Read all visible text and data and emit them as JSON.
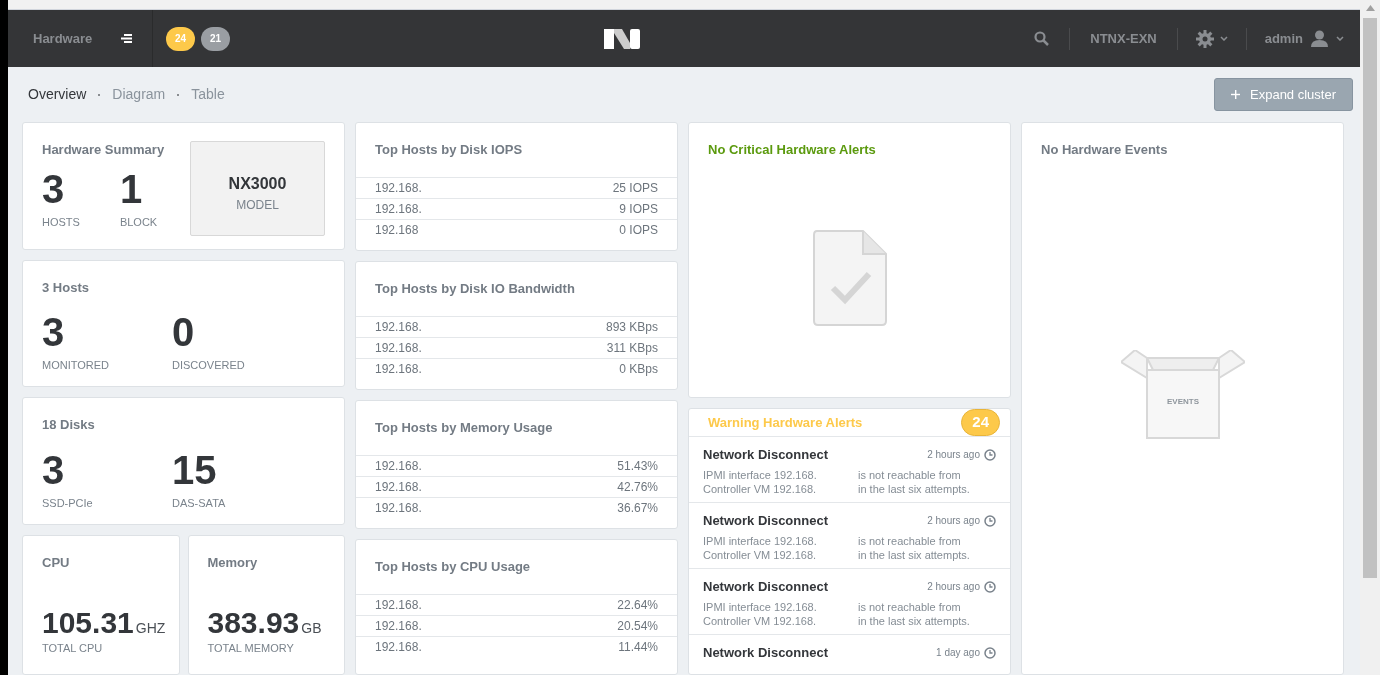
{
  "topbar": {
    "section": "Hardware",
    "badges": [
      {
        "count": "24",
        "color": "#fdc94a"
      },
      {
        "count": "21",
        "color": "#9a9ea3"
      }
    ],
    "cluster": "NTNX-EXN",
    "user": "admin"
  },
  "tabs": [
    {
      "label": "Overview",
      "selected": true
    },
    {
      "label": "Diagram",
      "selected": false
    },
    {
      "label": "Table",
      "selected": false
    }
  ],
  "expand_button": "Expand cluster",
  "summary": {
    "title": "Hardware Summary",
    "stats": [
      {
        "value": "3",
        "label": "HOSTS"
      },
      {
        "value": "1",
        "label": "BLOCK"
      }
    ],
    "model": "NX3000",
    "model_label": "MODEL"
  },
  "stat_cards": [
    {
      "title": "3 Hosts",
      "stats": [
        {
          "value": "3",
          "label": "MONITORED"
        },
        {
          "value": "0",
          "label": "DISCOVERED"
        }
      ]
    },
    {
      "title": "18 Disks",
      "stats": [
        {
          "value": "3",
          "label": "SSD-PCIe"
        },
        {
          "value": "15",
          "label": "DAS-SATA"
        }
      ]
    }
  ],
  "totals": [
    {
      "title": "CPU",
      "value": "105.31",
      "unit": "GHZ",
      "label": "TOTAL CPU"
    },
    {
      "title": "Memory",
      "value": "383.93",
      "unit": "GB",
      "label": "TOTAL MEMORY"
    }
  ],
  "top_lists": [
    {
      "title": "Top Hosts by Disk IOPS",
      "rows": [
        [
          "192.168.",
          "25 IOPS"
        ],
        [
          "192.168.",
          "9 IOPS"
        ],
        [
          "192.168",
          "0 IOPS"
        ]
      ]
    },
    {
      "title": "Top Hosts by Disk IO Bandwidth",
      "rows": [
        [
          "192.168.",
          "893 KBps"
        ],
        [
          "192.168.",
          "311 KBps"
        ],
        [
          "192.168.",
          "0 KBps"
        ]
      ]
    },
    {
      "title": "Top Hosts by Memory Usage",
      "rows": [
        [
          "192.168.",
          "51.43%"
        ],
        [
          "192.168.",
          "42.76%"
        ],
        [
          "192.168.",
          "36.67%"
        ]
      ]
    },
    {
      "title": "Top Hosts by CPU Usage",
      "rows": [
        [
          "192.168.",
          "22.64%"
        ],
        [
          "192.168.",
          "20.54%"
        ],
        [
          "192.168.",
          "11.44%"
        ]
      ]
    }
  ],
  "critical_alerts": {
    "title": "No Critical Hardware Alerts"
  },
  "warning_alerts": {
    "title": "Warning Hardware Alerts",
    "count": "24",
    "items": [
      {
        "title": "Network Disconnect",
        "time": "2 hours ago",
        "lines": [
          [
            "IPMI interface 192.168.",
            "is not reachable from"
          ],
          [
            "Controller VM 192.168.",
            "in the last six attempts."
          ]
        ]
      },
      {
        "title": "Network Disconnect",
        "time": "2 hours ago",
        "lines": [
          [
            "IPMI interface 192.168.",
            "is not reachable from"
          ],
          [
            "Controller VM 192.168.",
            "in the last six attempts."
          ]
        ]
      },
      {
        "title": "Network Disconnect",
        "time": "2 hours ago",
        "lines": [
          [
            "IPMI interface 192.168.",
            "is not reachable from"
          ],
          [
            "Controller VM 192.168.",
            "in the last six attempts."
          ]
        ]
      },
      {
        "title": "Network Disconnect",
        "time": "1 day ago"
      }
    ]
  },
  "events": {
    "title": "No Hardware Events",
    "box_label": "EVENTS"
  }
}
